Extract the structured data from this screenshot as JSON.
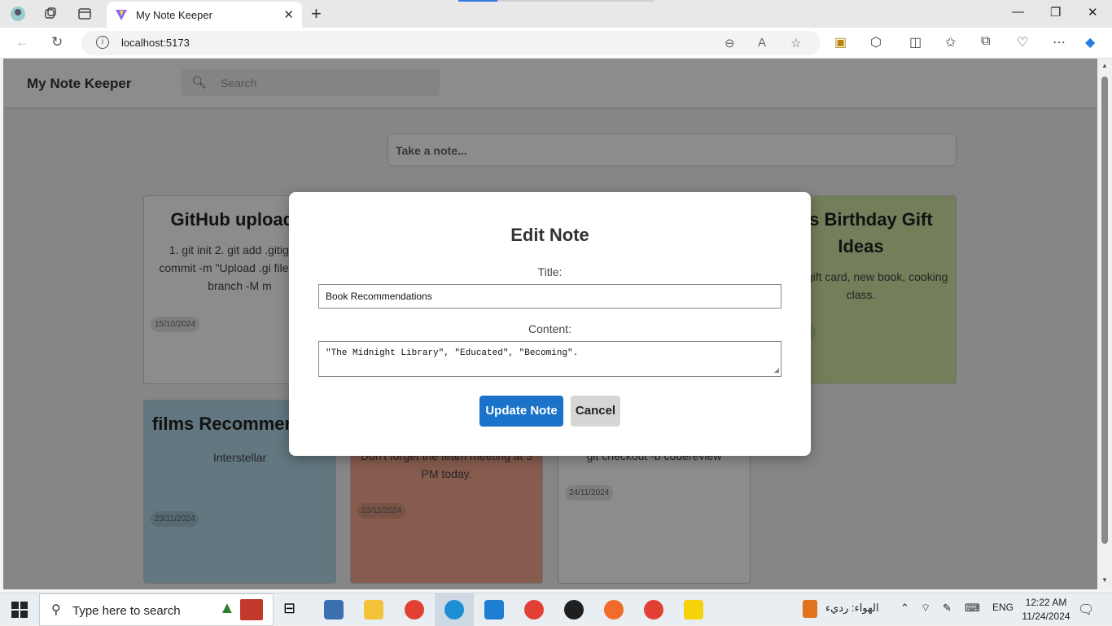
{
  "browser": {
    "tab_title": "My Note Keeper",
    "url": "localhost:5173"
  },
  "app": {
    "title": "My Note Keeper",
    "search_placeholder": "Search",
    "take_note_placeholder": "Take a note..."
  },
  "notes": [
    {
      "title": "GitHub upload s",
      "content": "1. git init 2. git add .gitign git commit -m \"Upload .gi file\" 4. git branch -M m",
      "date": "15/10/2024",
      "color": "#ffffff"
    },
    {
      "title": "m's Birthday Gift Ideas",
      "content": "y, spa gift card, new book, cooking class.",
      "date": "24",
      "color": "#cfe8a5"
    },
    {
      "title": "films Recommendati",
      "content": "Interstellar",
      "date": "23/11/2024",
      "color": "#b3d9ea"
    },
    {
      "title": "",
      "content": "Don't forget the team meeting at 3 PM today.",
      "date": "23/11/2024",
      "color": "#f4a88e"
    },
    {
      "title": "",
      "content": "git checkout -b codereview",
      "date": "24/11/2024",
      "color": "#ffffff"
    }
  ],
  "modal": {
    "heading": "Edit Note",
    "title_label": "Title:",
    "title_value": "Book Recommendations",
    "content_label": "Content:",
    "content_value": "\"The Midnight Library\", \"Educated\", \"Becoming\".",
    "update_label": "Update Note",
    "cancel_label": "Cancel"
  },
  "taskbar": {
    "search_text": "Type here to search",
    "weather": "الهواء: رديء",
    "lang": "ENG",
    "time": "12:22 AM",
    "date": "11/24/2024"
  },
  "colors": {
    "accent": "#1a73c8",
    "cancel": "#d6d6d6"
  }
}
